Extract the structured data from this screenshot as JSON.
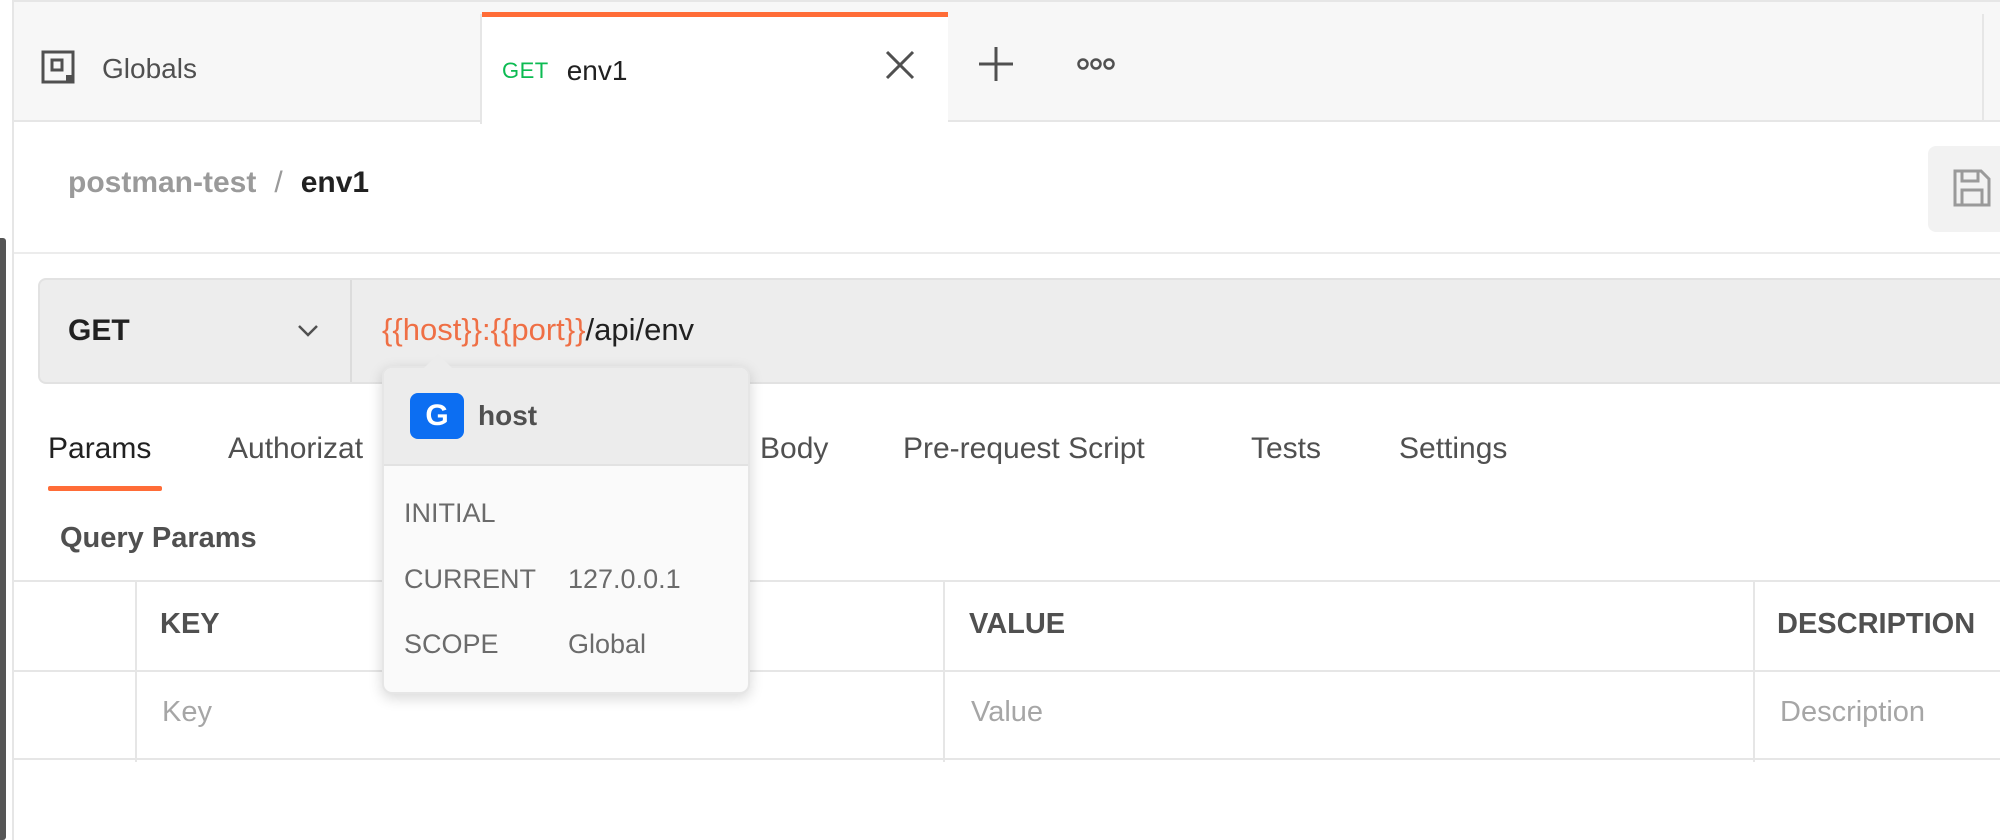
{
  "tabs": [
    {
      "label": "Globals",
      "icon": "globals-icon"
    },
    {
      "method": "GET",
      "label": "env1",
      "active": true
    }
  ],
  "breadcrumb": {
    "parent": "postman-test",
    "separator": "/",
    "current": "env1"
  },
  "request": {
    "method": "GET",
    "url": {
      "var1": "{{host}}",
      "sep": ":",
      "var2": "{{port}}",
      "path": "/api/env"
    }
  },
  "tooltip": {
    "badge": "G",
    "name": "host",
    "rows": [
      {
        "label": "INITIAL",
        "value": ""
      },
      {
        "label": "CURRENT",
        "value": "127.0.0.1"
      },
      {
        "label": "SCOPE",
        "value": "Global"
      }
    ]
  },
  "request_tabs": [
    "Params",
    "Authorizat",
    "Body",
    "Pre-request Script",
    "Tests",
    "Settings"
  ],
  "section_title": "Query Params",
  "params_table": {
    "headers": [
      "KEY",
      "VALUE",
      "DESCRIPTION"
    ],
    "placeholders": [
      "Key",
      "Value",
      "Description"
    ]
  },
  "colors": {
    "accent": "#ff6c37",
    "variable": "#f05a28",
    "method_get": "#0cbb52",
    "badge": "#0c6ef2"
  }
}
